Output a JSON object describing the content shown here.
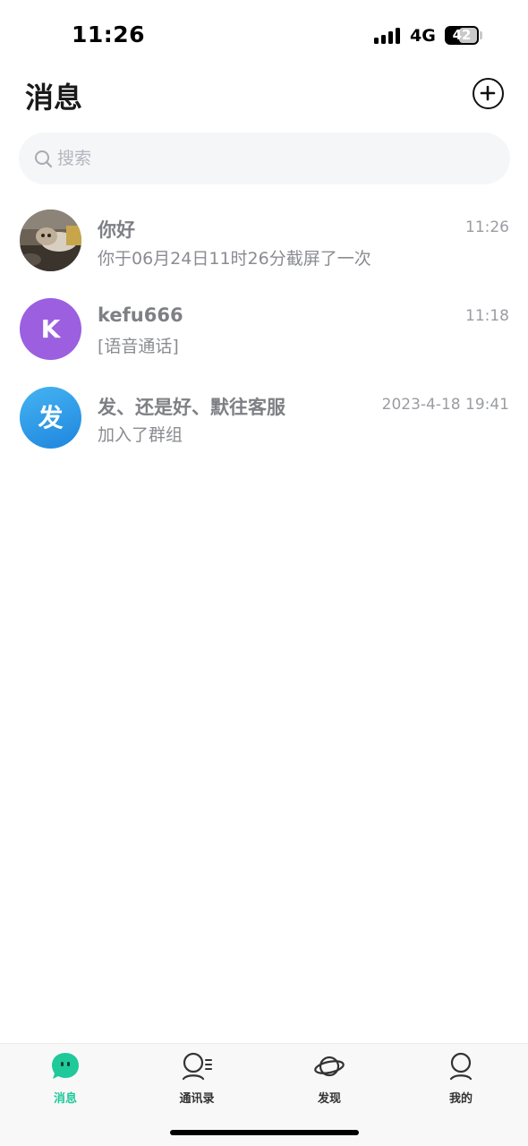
{
  "status_bar": {
    "time": "11:26",
    "network": "4G",
    "battery": "42"
  },
  "header": {
    "title": "消息",
    "add_icon": "plus-circle-icon"
  },
  "search": {
    "placeholder": "搜索",
    "icon": "search-icon"
  },
  "conversations": [
    {
      "name": "你好",
      "time": "11:26",
      "preview": "你于06月24日11时26分截屏了一次",
      "avatar_type": "photo"
    },
    {
      "name": "kefu666",
      "time": "11:18",
      "preview": "[语音通话]",
      "avatar_letter": "K",
      "avatar_color": "#9b5fe0"
    },
    {
      "name": "发、还是好、默往客服",
      "time": "2023-4-18 19:41",
      "preview": " 加入了群组",
      "avatar_letter": "发",
      "avatar_color": "#2f9ae8"
    }
  ],
  "tabs": [
    {
      "label": "消息",
      "icon": "chat-bubble-icon",
      "active": true
    },
    {
      "label": "通讯录",
      "icon": "contacts-icon",
      "active": false
    },
    {
      "label": "发现",
      "icon": "planet-icon",
      "active": false
    },
    {
      "label": "我的",
      "icon": "profile-icon",
      "active": false
    }
  ],
  "colors": {
    "accent": "#1fc99a",
    "search_bg": "#f4f6f8"
  }
}
